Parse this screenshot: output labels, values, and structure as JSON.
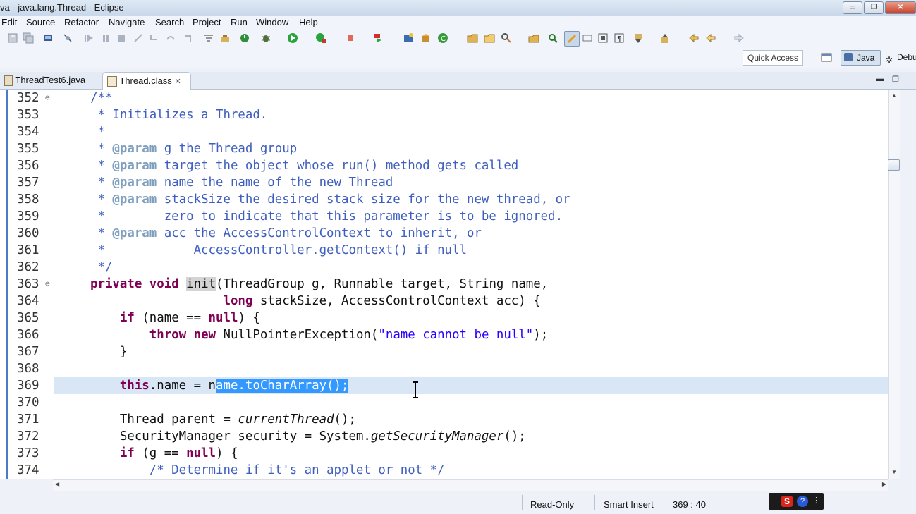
{
  "window": {
    "title": "va - java.lang.Thread - Eclipse",
    "buttons": [
      "▭",
      "❐",
      "✕"
    ]
  },
  "menu": [
    "Edit",
    "Source",
    "Refactor",
    "Navigate",
    "Search",
    "Project",
    "Run",
    "Window",
    "Help"
  ],
  "toolbar": {
    "quick_access": "Quick Access",
    "perspective_java": "Java",
    "perspective_debug": "Debu"
  },
  "tabs": [
    {
      "label": "ThreadTest6.java",
      "active": false
    },
    {
      "label": "Thread.class",
      "active": true,
      "close": "✕"
    }
  ],
  "editor": {
    "lines": [
      {
        "n": "352",
        "fold": "⊖"
      },
      {
        "n": "353"
      },
      {
        "n": "354"
      },
      {
        "n": "355"
      },
      {
        "n": "356"
      },
      {
        "n": "357"
      },
      {
        "n": "358"
      },
      {
        "n": "359"
      },
      {
        "n": "360"
      },
      {
        "n": "361"
      },
      {
        "n": "362"
      },
      {
        "n": "363",
        "fold": "⊖"
      },
      {
        "n": "364"
      },
      {
        "n": "365"
      },
      {
        "n": "366"
      },
      {
        "n": "367"
      },
      {
        "n": "368"
      },
      {
        "n": "369"
      },
      {
        "n": "370"
      },
      {
        "n": "371"
      },
      {
        "n": "372"
      },
      {
        "n": "373"
      },
      {
        "n": "374"
      }
    ],
    "code": {
      "l352": "/**",
      "l353": " * Initializes a Thread.",
      "l354": " *",
      "l355a": " * ",
      "l355b": "@param",
      "l355c": " g the Thread group",
      "l356a": " * ",
      "l356b": "@param",
      "l356c": " target the object whose run() method gets called",
      "l357a": " * ",
      "l357b": "@param",
      "l357c": " name the name of the new Thread",
      "l358a": " * ",
      "l358b": "@param",
      "l358c": " stackSize the desired stack size for the new thread, or",
      "l359": " *        zero to indicate that this parameter is to be ignored.",
      "l360a": " * ",
      "l360b": "@param",
      "l360c": " acc the AccessControlContext to inherit, or",
      "l361": " *            AccessController.getContext() if null",
      "l362": " */",
      "l363a": "private",
      "l363b": " ",
      "l363c": "void",
      "l363d": " ",
      "l363e": "init",
      "l363f": "(ThreadGroup g, Runnable target, String name,",
      "l364a": "                  ",
      "l364b": "long",
      "l364c": " stackSize, AccessControlContext acc) {",
      "l365a": "    ",
      "l365b": "if",
      "l365c": " (name == ",
      "l365d": "null",
      "l365e": ") {",
      "l366a": "        ",
      "l366b": "throw",
      "l366c": " ",
      "l366d": "new",
      "l366e": " NullPointerException(",
      "l366f": "\"name cannot be null\"",
      "l366g": ");",
      "l367": "    }",
      "l368": "",
      "l369a": "    ",
      "l369b": "this",
      "l369c": ".name = n",
      "l369d": "ame.toCharArray();",
      "l370": "",
      "l371a": "    Thread parent = ",
      "l371b": "currentThread",
      "l371c": "();",
      "l372a": "    SecurityManager security = System.",
      "l372b": "getSecurityManager",
      "l372c": "();",
      "l373a": "    ",
      "l373b": "if",
      "l373c": " (g == ",
      "l373d": "null",
      "l373e": ") {",
      "l374": "        /* Determine if it's an applet or not */"
    }
  },
  "status": {
    "readonly": "Read-Only",
    "insert_mode": "Smart Insert",
    "position": "369 : 40"
  },
  "colors": {
    "keyword": "#7f0055",
    "comment": "#3f5fbf",
    "string": "#2a00ff",
    "selection": "#3399ff",
    "current_line": "#d9e6f6"
  }
}
